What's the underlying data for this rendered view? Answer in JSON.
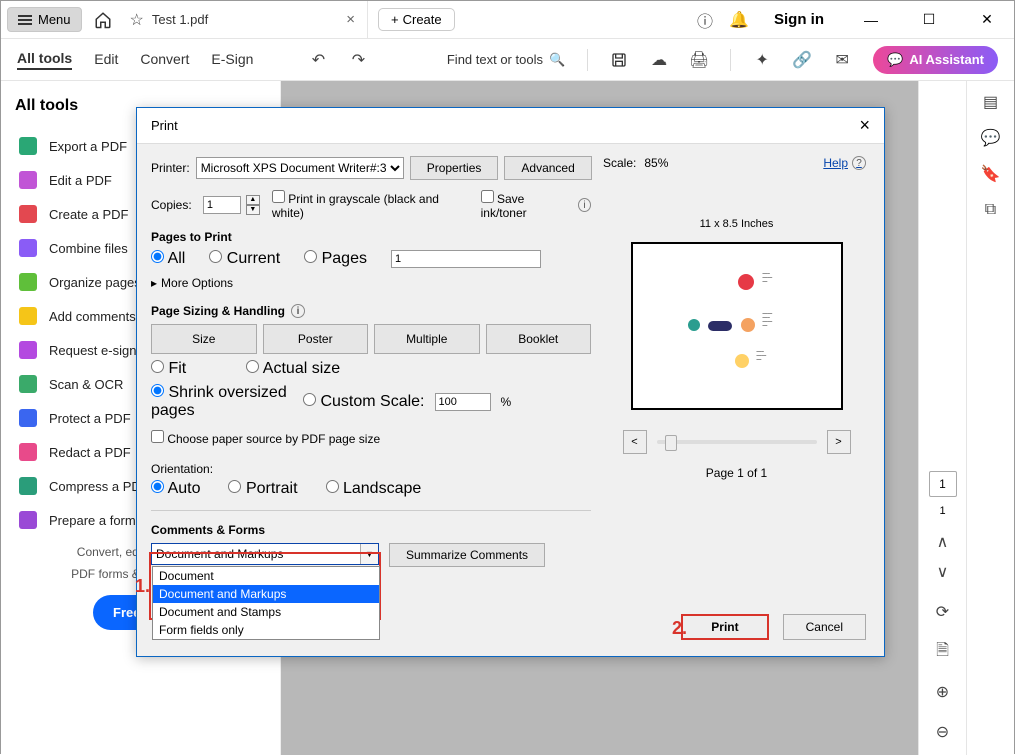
{
  "titlebar": {
    "menu": "Menu",
    "tab_title": "Test 1.pdf",
    "create": "Create",
    "signin": "Sign in"
  },
  "toolbar": {
    "items": [
      "All tools",
      "Edit",
      "Convert",
      "E-Sign"
    ],
    "search": "Find text or tools",
    "ai": "AI Assistant"
  },
  "sidebar": {
    "title": "All tools",
    "items": [
      "Export a PDF",
      "Edit a PDF",
      "Create a PDF",
      "Combine files",
      "Organize pages",
      "Add comments",
      "Request e-signatures",
      "Scan & OCR",
      "Protect a PDF",
      "Redact a PDF",
      "Compress a PDF",
      "Prepare a form"
    ],
    "note1": "Convert, edit and e-sign",
    "note2": "PDF forms & agreements.",
    "free_trial": "Free trial"
  },
  "page_thumb": {
    "current": "1",
    "total": "1"
  },
  "print": {
    "title": "Print",
    "printer_label": "Printer:",
    "printer_value": "Microsoft XPS Document Writer#:3",
    "properties": "Properties",
    "advanced": "Advanced",
    "help": "Help",
    "copies_label": "Copies:",
    "copies_value": "1",
    "grayscale": "Print in grayscale (black and white)",
    "saveink": "Save ink/toner",
    "pages_to_print": "Pages to Print",
    "pgopt_all": "All",
    "pgopt_current": "Current",
    "pgopt_pages": "Pages",
    "pages_input": "1",
    "more_options": "More Options",
    "sizing_head": "Page Sizing & Handling",
    "size_btn": "Size",
    "poster_btn": "Poster",
    "multiple_btn": "Multiple",
    "booklet_btn": "Booklet",
    "fit": "Fit",
    "actual": "Actual size",
    "shrink": "Shrink oversized pages",
    "custom": "Custom Scale:",
    "custom_val": "100",
    "percent": "%",
    "paper_source": "Choose paper source by PDF page size",
    "orientation": "Orientation:",
    "auto": "Auto",
    "portrait": "Portrait",
    "landscape": "Landscape",
    "comments_forms": "Comments & Forms",
    "cf_value": "Document and Markups",
    "cf_options": [
      "Document",
      "Document and Markups",
      "Document and Stamps",
      "Form fields only"
    ],
    "summarize": "Summarize Comments",
    "scale_label": "Scale:",
    "scale_value": "85%",
    "preview_dim": "11 x 8.5 Inches",
    "page_of": "Page 1 of 1",
    "print_btn": "Print",
    "cancel_btn": "Cancel"
  },
  "annotations": {
    "one": "1.",
    "two": "2."
  }
}
